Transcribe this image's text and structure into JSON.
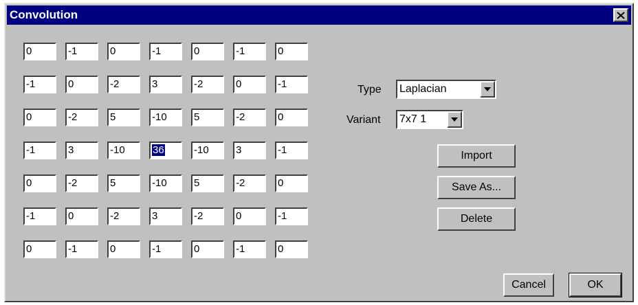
{
  "window": {
    "title": "Convolution"
  },
  "matrix": {
    "rows": [
      [
        "0",
        "-1",
        "0",
        "-1",
        "0",
        "-1",
        "0"
      ],
      [
        "-1",
        "0",
        "-2",
        "3",
        "-2",
        "0",
        "-1"
      ],
      [
        "0",
        "-2",
        "5",
        "-10",
        "5",
        "-2",
        "0"
      ],
      [
        "-1",
        "3",
        "-10",
        "36",
        "-10",
        "3",
        "-1"
      ],
      [
        "0",
        "-2",
        "5",
        "-10",
        "5",
        "-2",
        "0"
      ],
      [
        "-1",
        "0",
        "-2",
        "3",
        "-2",
        "0",
        "-1"
      ],
      [
        "0",
        "-1",
        "0",
        "-1",
        "0",
        "-1",
        "0"
      ]
    ]
  },
  "type": {
    "label": "Type",
    "value": "Laplacian"
  },
  "variant": {
    "label": "Variant",
    "value": "7x7 1"
  },
  "buttons": {
    "import": "Import",
    "save_as": "Save As...",
    "delete": "Delete",
    "cancel": "Cancel",
    "ok": "OK"
  },
  "icons": {
    "close": "close-icon",
    "dropdown": "chevron-down-icon"
  },
  "colors": {
    "titlebar": "#000080",
    "face": "#c0c0c0",
    "selection": "#000080"
  }
}
